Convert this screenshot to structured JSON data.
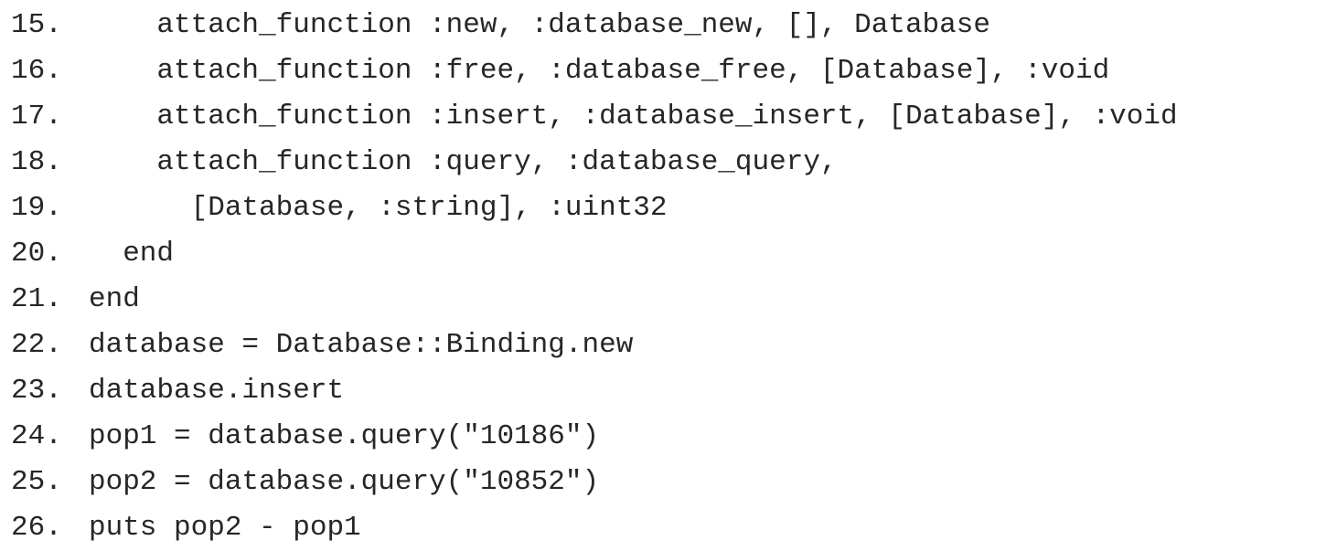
{
  "code_listing": {
    "lines": [
      {
        "number": "15.",
        "code": "    attach_function :new, :database_new, [], Database"
      },
      {
        "number": "16.",
        "code": "    attach_function :free, :database_free, [Database], :void"
      },
      {
        "number": "17.",
        "code": "    attach_function :insert, :database_insert, [Database], :void"
      },
      {
        "number": "18.",
        "code": "    attach_function :query, :database_query,"
      },
      {
        "number": "19.",
        "code": "      [Database, :string], :uint32"
      },
      {
        "number": "20.",
        "code": "  end"
      },
      {
        "number": "21.",
        "code": "end"
      },
      {
        "number": "22.",
        "code": "database = Database::Binding.new"
      },
      {
        "number": "23.",
        "code": "database.insert"
      },
      {
        "number": "24.",
        "code": "pop1 = database.query(\"10186\")"
      },
      {
        "number": "25.",
        "code": "pop2 = database.query(\"10852\")"
      },
      {
        "number": "26.",
        "code": "puts pop2 - pop1"
      }
    ]
  }
}
